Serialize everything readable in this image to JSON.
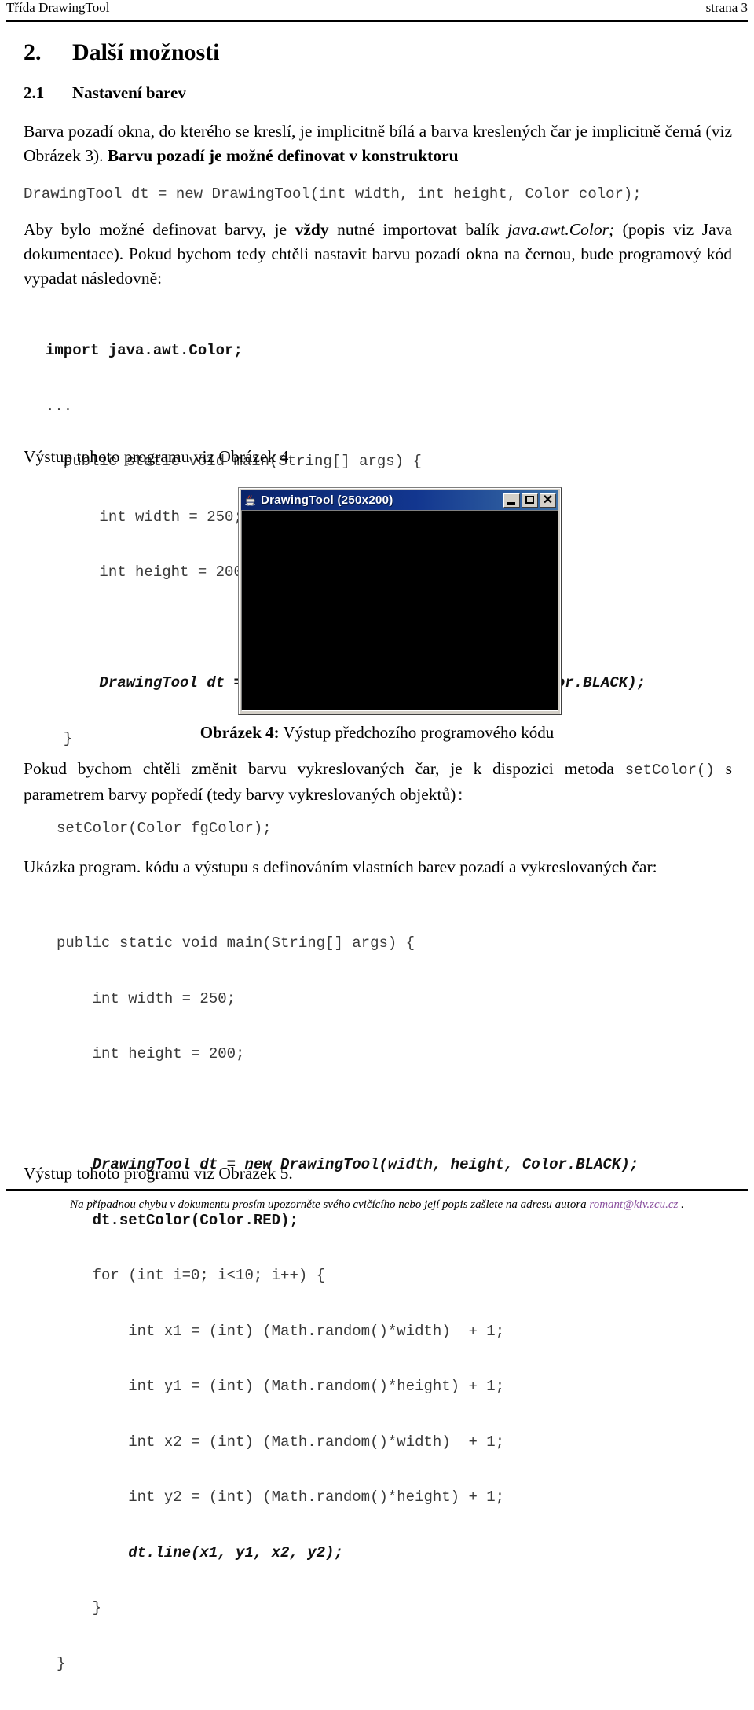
{
  "header": {
    "left": "Třída DrawingTool",
    "right": "strana 3"
  },
  "headings": {
    "h1_number": "2.",
    "h1_title": "Další možnosti",
    "h2_number": "2.1",
    "h2_title": "Nastavení barev"
  },
  "paragraphs": {
    "p1_a": "Barva pozadí okna, do kterého se kreslí, je implicitně bílá a barva kreslených čar je implicitně černá (viz Obrázek 3). ",
    "p1_b": "Barvu pozadí je možné definovat v konstruktoru",
    "signature_code": "DrawingTool dt = new DrawingTool(int width, int height, Color color);",
    "p2_a": "Aby bylo možné definovat barvy, je ",
    "p2_bold": "vždy",
    "p2_b": " nutné importovat balík ",
    "p2_italic": "java.awt.Color;",
    "p2_c": " (popis viz Java dokumentace). Pokud bychom tedy chtěli nastavit barvu pozadí okna na černou, bude programový kód vypadat následovně:",
    "p3_out1": "Výstup tohoto programu viz Obrázek 4.",
    "p4_a": "Pokud bychom chtěli změnit barvu vykreslovaných čar, je k dispozici metoda ",
    "p4_mono": "setColor()",
    "p4_b": " s parametrem barvy popředí (tedy barvy vykreslovaných objektů)",
    "p4_mono2": ":",
    "setcolor_sig": "setColor(Color fgColor);",
    "p5": "Ukázka program. kódu a výstupu s definováním vlastních barev pozadí a vykreslovaných čar:",
    "p6_out2": "Výstup tohoto programu viz Obrázek 5."
  },
  "code_block_1": {
    "line_import": "import java.awt.Color;",
    "line_dots": "...",
    "line_main": "  public static void main(String[] args) {",
    "line_width": "      int width = 250;",
    "line_height": "      int height = 200;",
    "line_blank": "",
    "line_dt": "      DrawingTool dt = new DrawingTool(width, height, Color.BLACK);",
    "line_close": "  }"
  },
  "code_block_2": {
    "line_main": "public static void main(String[] args) {",
    "line_width": "    int width = 250;",
    "line_height": "    int height = 200;",
    "line_dt": "    DrawingTool dt = new DrawingTool(width, height, Color.BLACK);",
    "line_setcolor": "    dt.setColor(Color.RED);",
    "line_for": "    for (int i=0; i<10; i++) {",
    "line_x1": "        int x1 = (int) (Math.random()*width)  + 1;",
    "line_y1": "        int y1 = (int) (Math.random()*height) + 1;",
    "line_x2": "        int x2 = (int) (Math.random()*width)  + 1;",
    "line_y2": "        int y2 = (int) (Math.random()*height) + 1;",
    "line_line": "        dt.line(x1, y1, x2, y2);",
    "line_close_for": "    }",
    "line_close_main": "}"
  },
  "figure": {
    "window_title": "DrawingTool (250x200)",
    "icon_name": "java-coffee-cup-icon",
    "minimize_label": "_",
    "maximize_label": "□",
    "close_label": "✕",
    "canvas_color": "#000000",
    "titlebar_color": "#0a246a",
    "caption_label": "Obrázek 4:",
    "caption_text": " Výstup předchozího programového kódu"
  },
  "footer": {
    "text_a": "Na případnou chybu v dokumentu prosím upozorněte svého cvičícího nebo její popis zašlete na adresu autora ",
    "email": "romant@kiv.zcu.cz",
    "text_b": " ."
  }
}
